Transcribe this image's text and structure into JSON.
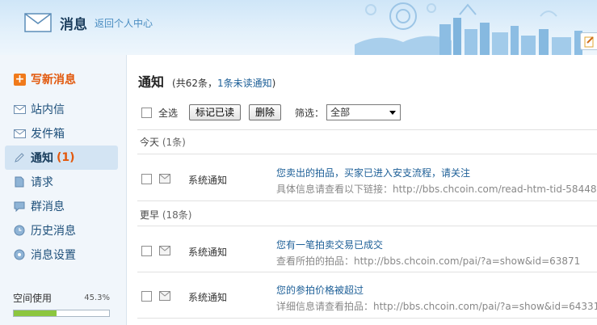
{
  "header": {
    "title": "消息",
    "back_link": "返回个人中心"
  },
  "sidebar": {
    "compose_label": "写新消息",
    "items": [
      {
        "label": "站内信",
        "icon": "envelope-icon",
        "active": false,
        "count": ""
      },
      {
        "label": "发件箱",
        "icon": "outbox-icon",
        "active": false,
        "count": ""
      },
      {
        "label": "通知",
        "icon": "pencil-icon",
        "active": true,
        "count": "(1)"
      },
      {
        "label": "请求",
        "icon": "document-icon",
        "active": false,
        "count": ""
      },
      {
        "label": "群消息",
        "icon": "chat-bubble-icon",
        "active": false,
        "count": ""
      },
      {
        "label": "历史消息",
        "icon": "clock-icon",
        "active": false,
        "count": ""
      },
      {
        "label": "消息设置",
        "icon": "gear-icon",
        "active": false,
        "count": ""
      }
    ],
    "quota": {
      "label": "空间使用",
      "percent": "45.3%",
      "fraction": 0.453
    }
  },
  "main": {
    "title": "通知",
    "summary_prefix": "(共62条，",
    "summary_unread": "1条未读通知",
    "summary_suffix": ")",
    "toolbar": {
      "select_all": "全选",
      "mark_read": "标记已读",
      "delete": "删除",
      "filter_label": "筛选：",
      "filter_value": "全部"
    },
    "groups": [
      {
        "label": "今天",
        "count": "(1条)",
        "rows": [
          {
            "sender": "系统通知",
            "subject": "您卖出的拍品，买家已进入安支流程，请关注",
            "detail": "具体信息请查看以下链接：http://bbs.chcoin.com/read-htm-tid-58448"
          }
        ]
      },
      {
        "label": "更早",
        "count": "(18条)",
        "rows": [
          {
            "sender": "系统通知",
            "subject": "您有一笔拍卖交易已成交",
            "detail": "查看所拍的拍品：http://bbs.chcoin.com/pai/?a=show&id=63871"
          },
          {
            "sender": "系统通知",
            "subject": "您的参拍价格被超过",
            "detail": "详细信息请查看拍品：http://bbs.chcoin.com/pai/?a=show&id=64331"
          }
        ]
      }
    ]
  },
  "colors": {
    "accent_orange": "#e2580c",
    "link_blue": "#1d5f97",
    "quota_green": "#8cc63f"
  }
}
